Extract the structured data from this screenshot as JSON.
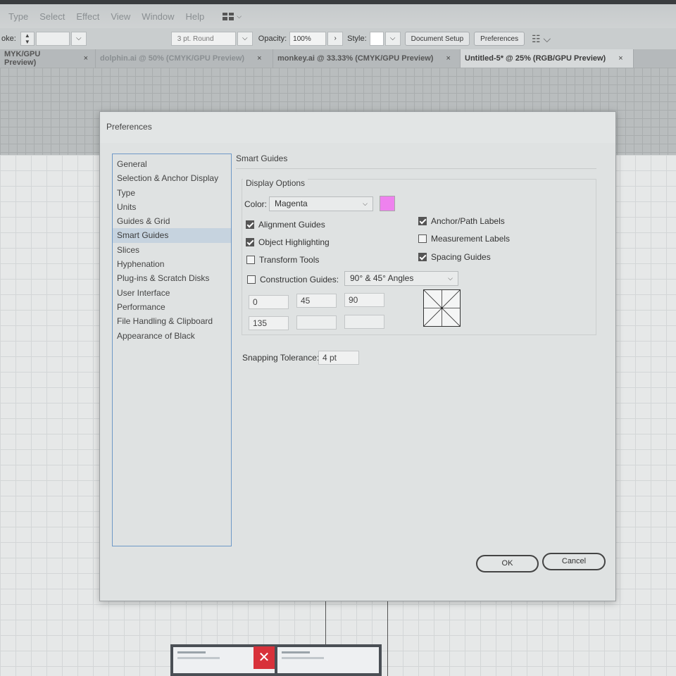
{
  "menubar": {
    "items": [
      "Type",
      "Select",
      "Effect",
      "View",
      "Window",
      "Help"
    ]
  },
  "controlbar": {
    "stroke_label": "oke:",
    "stroke_profile": "3 pt. Round",
    "opacity_label": "Opacity:",
    "opacity_value": "100%",
    "style_label": "Style:",
    "document_setup": "Document Setup",
    "preferences": "Preferences"
  },
  "tabs": [
    {
      "label": "MYK/GPU Preview)"
    },
    {
      "label": "dolphin.ai @ 50% (CMYK/GPU Preview)"
    },
    {
      "label": "monkey.ai @ 33.33% (CMYK/GPU Preview)"
    },
    {
      "label": "Untitled-5* @ 25% (RGB/GPU Preview)"
    }
  ],
  "dialog": {
    "title": "Preferences",
    "nav": [
      "General",
      "Selection & Anchor Display",
      "Type",
      "Units",
      "Guides & Grid",
      "Smart Guides",
      "Slices",
      "Hyphenation",
      "Plug-ins & Scratch Disks",
      "User Interface",
      "Performance",
      "File Handling & Clipboard",
      "Appearance of Black"
    ],
    "selected_nav": "Smart Guides",
    "section_title": "Smart Guides",
    "display_options": {
      "title": "Display Options",
      "color_label": "Color:",
      "color_value": "Magenta",
      "swatch_color": "#ee82ee",
      "checks": {
        "alignment_guides": {
          "label": "Alignment Guides",
          "checked": true
        },
        "object_highlighting": {
          "label": "Object Highlighting",
          "checked": true
        },
        "transform_tools": {
          "label": "Transform Tools",
          "checked": false
        },
        "construction_guides": {
          "label": "Construction Guides:",
          "checked": false
        },
        "anchor_path_labels": {
          "label": "Anchor/Path Labels",
          "checked": true
        },
        "measurement_labels": {
          "label": "Measurement Labels",
          "checked": false
        },
        "spacing_guides": {
          "label": "Spacing Guides",
          "checked": true
        }
      },
      "angles_preset": "90° & 45° Angles",
      "angles": [
        "0",
        "45",
        "90",
        "135",
        "",
        ""
      ]
    },
    "snapping_label": "Snapping Tolerance:",
    "snapping_value": "4 pt",
    "ok": "OK",
    "cancel": "Cancel"
  },
  "taskbar": {
    "close_glyph": "✕"
  }
}
